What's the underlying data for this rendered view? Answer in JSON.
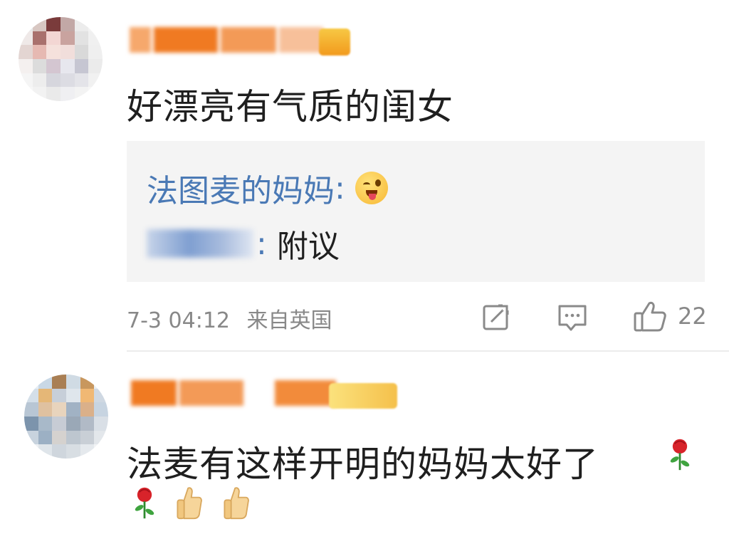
{
  "comments": [
    {
      "body": "好漂亮有气质的闺女",
      "reply": {
        "line1_name": "法图麦的妈妈",
        "line1_colon": ":",
        "line1_emoji": "wink-tongue-emoji",
        "line2_colon": ":",
        "line2_text": "附议"
      },
      "meta": {
        "time": "7-3 04:12",
        "location": "来自英国"
      },
      "actions": {
        "share_icon": "share-icon",
        "reply_icon": "comment-icon",
        "like_icon": "thumbs-up-icon",
        "like_count": "22"
      }
    },
    {
      "body_line1": "法麦有这样开明的妈妈太好了",
      "emojis_line1": [
        "rose-emoji"
      ],
      "emojis_line2": [
        "rose-emoji",
        "thumbs-up-emoji",
        "thumbs-up-emoji"
      ]
    }
  ],
  "colors": {
    "reply_name": "#4a79b5",
    "meta_text": "#888888",
    "reply_bg": "#f4f4f4",
    "username_orange": "#f07a22"
  }
}
